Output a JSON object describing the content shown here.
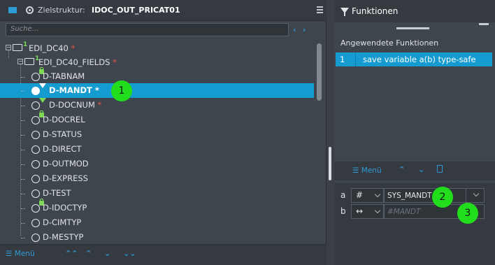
{
  "left": {
    "header": {
      "label": "Zielstruktur:",
      "value": "IDOC_OUT_PRICAT01"
    },
    "search": {
      "placeholder": "Suche...",
      "prev": "‹",
      "next": "›"
    },
    "tree": [
      {
        "label": "EDI_DC40",
        "required": "*",
        "level": "1"
      },
      {
        "label": "EDI_DC40_FIELDS",
        "required": "*",
        "level": "1"
      },
      {
        "label": "D-TABNAM",
        "required": "",
        "badge": "lock"
      },
      {
        "label": "D-MANDT",
        "required": "*",
        "badge": "filter",
        "selected": true
      },
      {
        "label": "D-DOCNUM",
        "required": "*",
        "badge": "filter"
      },
      {
        "label": "D-DOCREL",
        "required": "",
        "badge": "lock"
      },
      {
        "label": "D-STATUS",
        "required": ""
      },
      {
        "label": "D-DIRECT",
        "required": ""
      },
      {
        "label": "D-OUTMOD",
        "required": ""
      },
      {
        "label": "D-EXPRESS",
        "required": ""
      },
      {
        "label": "D-TEST",
        "required": ""
      },
      {
        "label": "D-IDOCTYP",
        "required": "",
        "badge": "lock"
      },
      {
        "label": "D-CIMTYP",
        "required": ""
      },
      {
        "label": "D-MESTYP",
        "required": ""
      }
    ],
    "footer": {
      "menu": "Menü",
      "collapse_all": "⌃⌃",
      "up": "⌃",
      "down": "⌄",
      "expand_all": "⌄⌄"
    }
  },
  "right": {
    "title": "Funktionen",
    "applied_label": "Angewendete Funktionen",
    "functions": [
      {
        "index": "1",
        "name": "save variable a(b) type-safe"
      }
    ],
    "toolbar": {
      "menu": "Menü",
      "up": "⌃",
      "down": "⌄"
    },
    "params": [
      {
        "label": "a",
        "type_symbol": "#",
        "value": "SYS_MANDT",
        "placeholder": ""
      },
      {
        "label": "b",
        "type_symbol": "↔",
        "value": "",
        "placeholder": "#MANDT"
      }
    ]
  },
  "callouts": [
    "1",
    "2",
    "3"
  ],
  "colors": {
    "selection": "#159bd0",
    "accent": "#2f9bd6",
    "required": "#e2574c",
    "callout": "#22dd1c",
    "lock_icon": "#7ed957"
  }
}
